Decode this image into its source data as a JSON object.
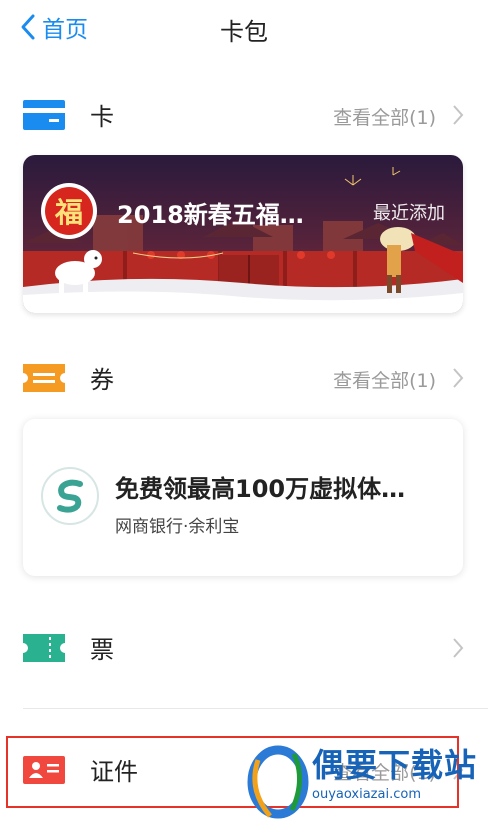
{
  "nav": {
    "back_label": "首页",
    "title": "卡包"
  },
  "sections": {
    "cards": {
      "label": "卡",
      "more": "查看全部(1)",
      "icon": "card-icon",
      "color": "#1a8cf0"
    },
    "coupons": {
      "label": "券",
      "more": "查看全部(1)",
      "icon": "coupon-icon",
      "color": "#f59a23"
    },
    "tickets": {
      "label": "票",
      "icon": "ticket-icon",
      "color": "#2ab190"
    },
    "ids": {
      "label": "证件",
      "more": "查看全部(1)",
      "icon": "id-card-icon",
      "color": "#f0483e"
    }
  },
  "card_item": {
    "badge_char": "福",
    "title": "2018新春五福…",
    "tag": "最近添加"
  },
  "coupon_item": {
    "title": "免费领最高100万虚拟体…",
    "subtitle": "网商银行·余利宝"
  },
  "watermark": {
    "text": "偶要下载站",
    "url": "ouyaoxiazai.com"
  }
}
